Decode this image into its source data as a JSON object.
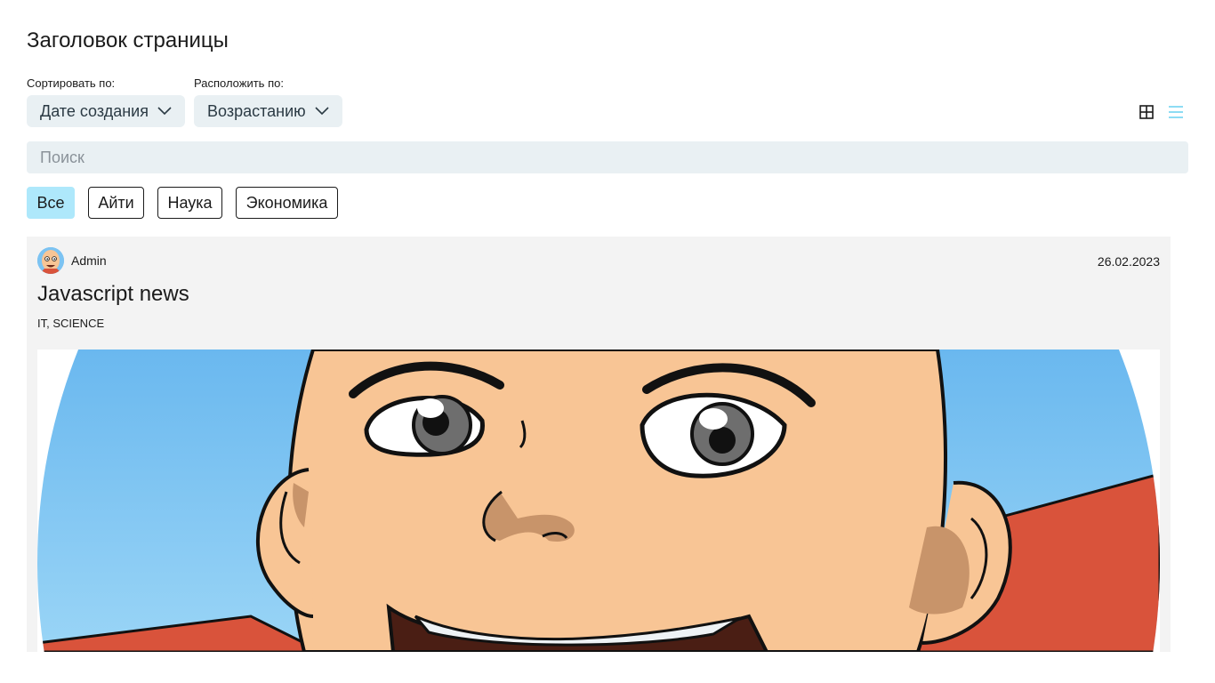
{
  "page": {
    "title": "Заголовок страницы"
  },
  "sort": {
    "label": "Сортировать по:",
    "value": "Дате создания"
  },
  "order": {
    "label": "Расположить по:",
    "value": "Возрастанию"
  },
  "view": {
    "active": "list",
    "icons": [
      "grid-icon",
      "list-icon"
    ],
    "active_color": "#5ccdf0"
  },
  "search": {
    "placeholder": "Поиск",
    "value": ""
  },
  "tabs": [
    {
      "label": "Все",
      "active": true
    },
    {
      "label": "Айти",
      "active": false
    },
    {
      "label": "Наука",
      "active": false
    },
    {
      "label": "Экономика",
      "active": false
    }
  ],
  "articles": [
    {
      "author": "Admin",
      "date": "26.02.2023",
      "title": "Javascript news",
      "tags": "IT, SCIENCE",
      "image": "cartoon-boy-illustration"
    }
  ],
  "colors": {
    "field_bg": "#e9f0f3",
    "active_tab": "#aee8fb",
    "card_bg": "#f3f3f3"
  }
}
